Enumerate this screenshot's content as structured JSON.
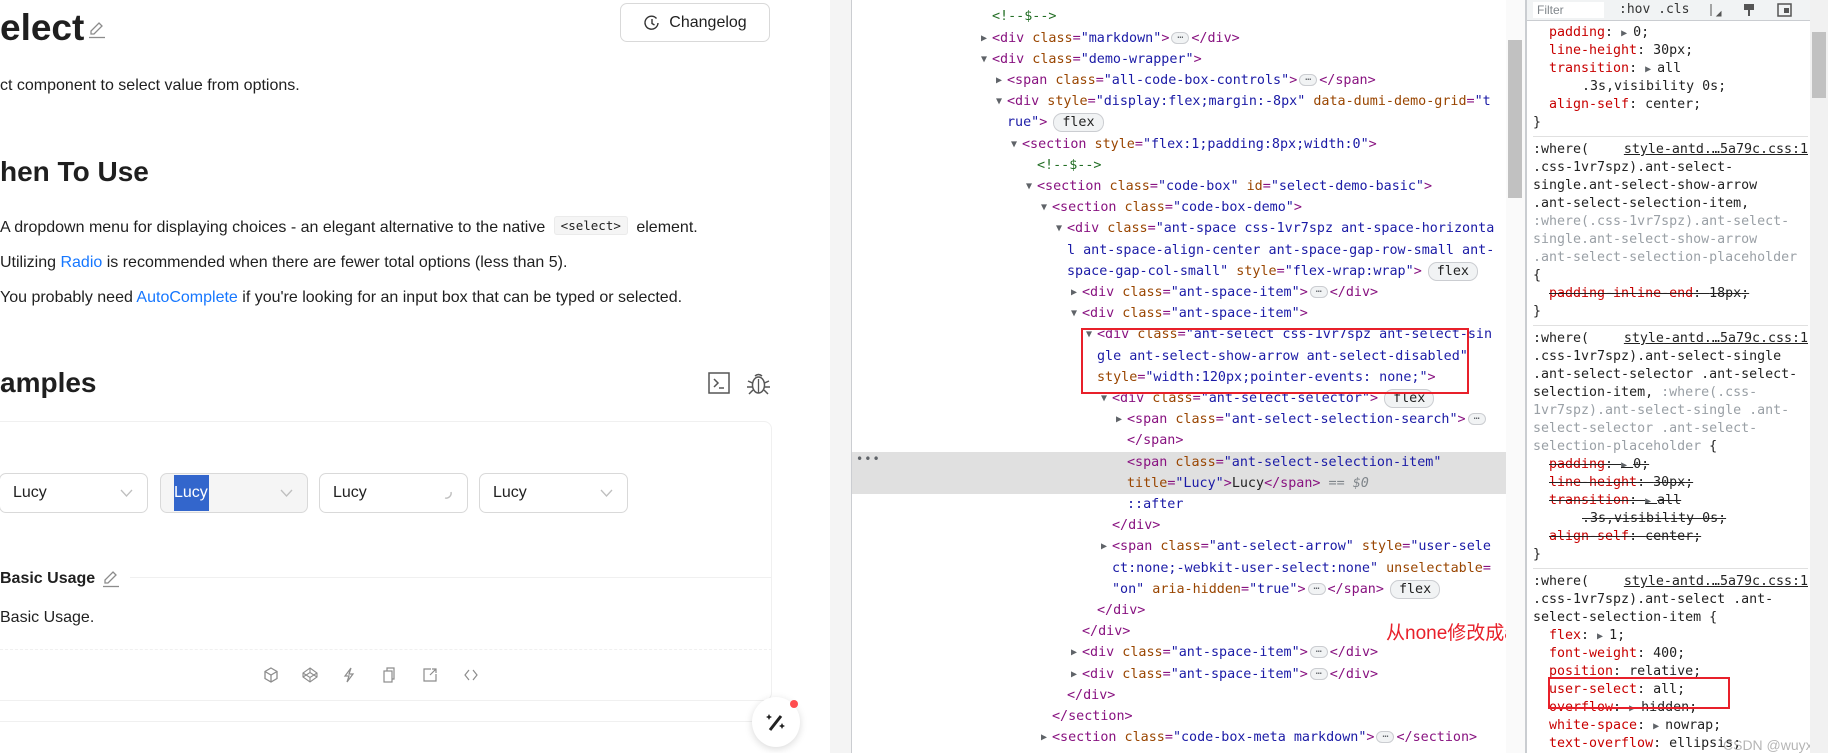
{
  "page": {
    "title": "elect",
    "changelog_label": "Changelog",
    "subtitle": "ct component to select value from options.",
    "when_heading": "hen To Use",
    "bullets": [
      {
        "pre": "A dropdown menu for displaying choices - an elegant alternative to the native ",
        "code": "<select>",
        "post": " element."
      },
      {
        "pre": "Utilizing ",
        "link": "Radio",
        "post": " is recommended when there are fewer total options (less than 5)."
      },
      {
        "pre": "You probably need ",
        "link": "AutoComplete",
        "post": " if you're looking for an input box that can be typed or selected."
      }
    ],
    "examples_heading": "amples",
    "accent": "#1677ff",
    "demo": {
      "selects": [
        {
          "value": "Lucy",
          "state": "default",
          "icon": "chevron-down"
        },
        {
          "value": "Lucy",
          "state": "disabled",
          "text_selected": true,
          "icon": "chevron-down"
        },
        {
          "value": "Lucy",
          "state": "loading",
          "icon": "spinner"
        },
        {
          "value": "Lucy",
          "state": "default",
          "icon": "chevron-down"
        }
      ],
      "title": "Basic Usage",
      "description": "Basic Usage.",
      "actions": [
        "codesandbox-icon",
        "codepen-icon",
        "stackblitz-icon",
        "copy-icon",
        "external-link-icon",
        "code-icon"
      ]
    }
  },
  "elements": {
    "lines": [
      {
        "d": 0,
        "seg": [
          [
            "comment",
            "<!--$-->"
          ]
        ]
      },
      {
        "d": 0,
        "arrow": "closed",
        "seg": [
          [
            "tag",
            "<div"
          ],
          [
            "attr",
            " class"
          ],
          [
            "tag",
            "="
          ],
          [
            "val",
            "\"markdown\""
          ],
          [
            "tag",
            ">"
          ],
          [
            "ell",
            "…"
          ],
          [
            "tag",
            "</div>"
          ]
        ]
      },
      {
        "d": 0,
        "arrow": "open",
        "seg": [
          [
            "tag",
            "<div"
          ],
          [
            "attr",
            " class"
          ],
          [
            "tag",
            "="
          ],
          [
            "val",
            "\"demo-wrapper\""
          ],
          [
            "tag",
            ">"
          ]
        ]
      },
      {
        "d": 1,
        "arrow": "closed",
        "seg": [
          [
            "tag",
            "<span"
          ],
          [
            "attr",
            " class"
          ],
          [
            "tag",
            "="
          ],
          [
            "val",
            "\"all-code-box-controls\""
          ],
          [
            "tag",
            ">"
          ],
          [
            "ell",
            "…"
          ],
          [
            "tag",
            "</span>"
          ]
        ]
      },
      {
        "d": 1,
        "arrow": "open",
        "seg": [
          [
            "tag",
            "<div"
          ],
          [
            "attr",
            " style"
          ],
          [
            "tag",
            "="
          ],
          [
            "val",
            "\"display:flex;margin:-8px\""
          ],
          [
            "attr",
            " data-dumi-demo-grid"
          ],
          [
            "tag",
            "="
          ],
          [
            "val",
            "\"t"
          ]
        ]
      },
      {
        "d": 1,
        "seg": [
          [
            "val",
            "rue\""
          ],
          [
            "tag",
            ">"
          ],
          [
            "badge",
            "flex"
          ]
        ]
      },
      {
        "d": 2,
        "arrow": "open",
        "seg": [
          [
            "tag",
            "<section"
          ],
          [
            "attr",
            " style"
          ],
          [
            "tag",
            "="
          ],
          [
            "val",
            "\"flex:1;padding:8px;width:0\""
          ],
          [
            "tag",
            ">"
          ]
        ]
      },
      {
        "d": 3,
        "seg": [
          [
            "comment",
            "<!--$-->"
          ]
        ]
      },
      {
        "d": 3,
        "arrow": "open",
        "seg": [
          [
            "tag",
            "<section"
          ],
          [
            "attr",
            " class"
          ],
          [
            "tag",
            "="
          ],
          [
            "val",
            "\"code-box\""
          ],
          [
            "attr",
            " id"
          ],
          [
            "tag",
            "="
          ],
          [
            "val",
            "\"select-demo-basic\""
          ],
          [
            "tag",
            ">"
          ]
        ]
      },
      {
        "d": 4,
        "arrow": "open",
        "seg": [
          [
            "tag",
            "<section"
          ],
          [
            "attr",
            " class"
          ],
          [
            "tag",
            "="
          ],
          [
            "val",
            "\"code-box-demo\""
          ],
          [
            "tag",
            ">"
          ]
        ]
      },
      {
        "d": 5,
        "arrow": "open",
        "seg": [
          [
            "tag",
            "<div"
          ],
          [
            "attr",
            " class"
          ],
          [
            "tag",
            "="
          ],
          [
            "val",
            "\"ant-space css-1vr7spz ant-space-horizonta"
          ]
        ]
      },
      {
        "d": 5,
        "seg": [
          [
            "val",
            "l ant-space-align-center ant-space-gap-row-small ant-"
          ]
        ]
      },
      {
        "d": 5,
        "seg": [
          [
            "val",
            "space-gap-col-small\""
          ],
          [
            "attr",
            " style"
          ],
          [
            "tag",
            "="
          ],
          [
            "val",
            "\"flex-wrap:wrap\""
          ],
          [
            "tag",
            ">"
          ],
          [
            "badge",
            "flex"
          ]
        ]
      },
      {
        "d": 6,
        "arrow": "closed",
        "seg": [
          [
            "tag",
            "<div"
          ],
          [
            "attr",
            " class"
          ],
          [
            "tag",
            "="
          ],
          [
            "val",
            "\"ant-space-item\""
          ],
          [
            "tag",
            ">"
          ],
          [
            "ell",
            "…"
          ],
          [
            "tag",
            "</div>"
          ]
        ]
      },
      {
        "d": 6,
        "arrow": "open",
        "seg": [
          [
            "tag",
            "<div"
          ],
          [
            "attr",
            " class"
          ],
          [
            "tag",
            "="
          ],
          [
            "val",
            "\"ant-space-item\""
          ],
          [
            "tag",
            ">"
          ]
        ]
      },
      {
        "d": 7,
        "arrow": "open",
        "seg": [
          [
            "tag",
            "<div"
          ],
          [
            "attr",
            " class"
          ],
          [
            "tag",
            "="
          ],
          [
            "val",
            "\"ant-select css-1vr7spz ant-select-sin"
          ]
        ]
      },
      {
        "d": 7,
        "seg": [
          [
            "val",
            "gle ant-select-show-arrow ant-select-disabled\""
          ]
        ]
      },
      {
        "d": 7,
        "seg": [
          [
            "attr",
            "style"
          ],
          [
            "tag",
            "="
          ],
          [
            "val",
            "\"width:120px;pointer-events: none;\""
          ],
          [
            "tag",
            ">"
          ]
        ]
      },
      {
        "d": 8,
        "arrow": "open",
        "seg": [
          [
            "tag",
            "<div"
          ],
          [
            "attr",
            " class"
          ],
          [
            "tag",
            "="
          ],
          [
            "val",
            "\"ant-select-selector\""
          ],
          [
            "tag",
            ">"
          ],
          [
            "badge",
            "flex"
          ]
        ]
      },
      {
        "d": 9,
        "arrow": "closed",
        "seg": [
          [
            "tag",
            "<span"
          ],
          [
            "attr",
            " class"
          ],
          [
            "tag",
            "="
          ],
          [
            "val",
            "\"ant-select-selection-search\""
          ],
          [
            "tag",
            ">"
          ],
          [
            "ell",
            "…"
          ]
        ]
      },
      {
        "d": 9,
        "seg": [
          [
            "tag",
            "</span>"
          ]
        ]
      },
      {
        "d": 9,
        "selected": true,
        "dots": "•••",
        "seg": [
          [
            "tag",
            "<span"
          ],
          [
            "attr",
            " class"
          ],
          [
            "tag",
            "="
          ],
          [
            "val",
            "\"ant-select-selection-item\""
          ]
        ]
      },
      {
        "d": 9,
        "selected": true,
        "seg": [
          [
            "attr",
            "title"
          ],
          [
            "tag",
            "="
          ],
          [
            "val",
            "\"Lucy\""
          ],
          [
            "tag",
            ">"
          ],
          [
            "text",
            "Lucy"
          ],
          [
            "tag",
            "</span>"
          ],
          [
            "dollar",
            " == $0"
          ]
        ]
      },
      {
        "d": 9,
        "seg": [
          [
            "pseudo",
            "::after"
          ]
        ]
      },
      {
        "d": 8,
        "seg": [
          [
            "tag",
            "</div>"
          ]
        ]
      },
      {
        "d": 8,
        "arrow": "closed",
        "seg": [
          [
            "tag",
            "<span"
          ],
          [
            "attr",
            " class"
          ],
          [
            "tag",
            "="
          ],
          [
            "val",
            "\"ant-select-arrow\""
          ],
          [
            "attr",
            " style"
          ],
          [
            "tag",
            "="
          ],
          [
            "val",
            "\"user-sele"
          ]
        ]
      },
      {
        "d": 8,
        "seg": [
          [
            "val",
            "ct:none;-webkit-user-select:none\""
          ],
          [
            "attr",
            " unselectable"
          ],
          [
            "tag",
            "="
          ]
        ]
      },
      {
        "d": 8,
        "seg": [
          [
            "val",
            "\"on\""
          ],
          [
            "attr",
            " aria-hidden"
          ],
          [
            "tag",
            "="
          ],
          [
            "val",
            "\"true\""
          ],
          [
            "tag",
            ">"
          ],
          [
            "ell",
            "…"
          ],
          [
            "tag",
            "</span>"
          ],
          [
            "badge",
            "flex"
          ]
        ]
      },
      {
        "d": 7,
        "seg": [
          [
            "tag",
            "</div>"
          ]
        ]
      },
      {
        "d": 6,
        "seg": [
          [
            "tag",
            "</div>"
          ]
        ]
      },
      {
        "d": 6,
        "arrow": "closed",
        "seg": [
          [
            "tag",
            "<div"
          ],
          [
            "attr",
            " class"
          ],
          [
            "tag",
            "="
          ],
          [
            "val",
            "\"ant-space-item\""
          ],
          [
            "tag",
            ">"
          ],
          [
            "ell",
            "…"
          ],
          [
            "tag",
            "</div>"
          ]
        ]
      },
      {
        "d": 6,
        "arrow": "closed",
        "seg": [
          [
            "tag",
            "<div"
          ],
          [
            "attr",
            " class"
          ],
          [
            "tag",
            "="
          ],
          [
            "val",
            "\"ant-space-item\""
          ],
          [
            "tag",
            ">"
          ],
          [
            "ell",
            "…"
          ],
          [
            "tag",
            "</div>"
          ]
        ]
      },
      {
        "d": 5,
        "seg": [
          [
            "tag",
            "</div>"
          ]
        ]
      },
      {
        "d": 4,
        "seg": [
          [
            "tag",
            "</section>"
          ]
        ]
      },
      {
        "d": 4,
        "arrow": "closed",
        "seg": [
          [
            "tag",
            "<section"
          ],
          [
            "attr",
            " class"
          ],
          [
            "tag",
            "="
          ],
          [
            "val",
            "\"code-box-meta markdown\""
          ],
          [
            "tag",
            ">"
          ],
          [
            "ell",
            "…"
          ],
          [
            "tag",
            "</section>"
          ]
        ]
      }
    ],
    "annotation": "从none修改成all",
    "annotation_color": "#e8202a"
  },
  "styles": {
    "filter_placeholder": "Filter",
    "hov_cls": ":hov .cls",
    "rules": [
      {
        "lines": [
          {
            "p": "padding",
            "v": "0",
            "arrow": true
          },
          {
            "p": "line-height",
            "v": "30px"
          },
          {
            "p": "transition",
            "v": "all",
            "arrow": true,
            "semi": false
          },
          {
            "c": ".3s,visibility 0s;"
          },
          {
            "p": "align-self",
            "v": "center"
          },
          {
            "b": "}"
          }
        ]
      },
      {
        "lines": [
          {
            "segs": [
              [
                "s",
                ":where("
              ]
            ],
            "link": "style-antd.…5a79c.css:1"
          },
          {
            "segs": [
              [
                "s",
                ".css-1vr7spz).ant-select-"
              ]
            ]
          },
          {
            "segs": [
              [
                "s",
                "single.ant-select-show-arrow"
              ]
            ]
          },
          {
            "segs": [
              [
                "s",
                ".ant-select-selection-item,"
              ]
            ]
          },
          {
            "segs": [
              [
                "g",
                ":where(.css-1vr7spz).ant-select-"
              ]
            ]
          },
          {
            "segs": [
              [
                "g",
                "single.ant-select-show-arrow"
              ]
            ]
          },
          {
            "segs": [
              [
                "g",
                ".ant-select-selection-placeholder"
              ]
            ]
          },
          {
            "b": "{"
          },
          {
            "p": "padding-inline-end",
            "v": "18px",
            "x": true
          },
          {
            "b": "}"
          }
        ]
      },
      {
        "lines": [
          {
            "segs": [
              [
                "s",
                ":where("
              ]
            ],
            "link": "style-antd.…5a79c.css:1"
          },
          {
            "segs": [
              [
                "s",
                ".css-1vr7spz).ant-select-single"
              ]
            ]
          },
          {
            "segs": [
              [
                "s",
                ".ant-select-selector .ant-select-"
              ]
            ]
          },
          {
            "segs": [
              [
                "s",
                "selection-item, "
              ],
              [
                "g",
                ":where(.css-"
              ]
            ]
          },
          {
            "segs": [
              [
                "g",
                "1vr7spz).ant-select-single .ant-"
              ]
            ]
          },
          {
            "segs": [
              [
                "g",
                "select-selector .ant-select-"
              ]
            ]
          },
          {
            "segs": [
              [
                "g",
                "selection-placeholder"
              ],
              [
                "s",
                " {"
              ]
            ]
          },
          {
            "p": "padding",
            "v": "0",
            "arrow": true,
            "x": true
          },
          {
            "p": "line-height",
            "v": "30px",
            "x": true
          },
          {
            "p": "transition",
            "v": "all",
            "arrow": true,
            "x": true,
            "semi": false
          },
          {
            "c": ".3s,visibility 0s;",
            "x": true
          },
          {
            "p": "align-self",
            "v": "center",
            "x": true
          },
          {
            "b": "}"
          }
        ]
      },
      {
        "lines": [
          {
            "segs": [
              [
                "s",
                ":where("
              ]
            ],
            "link": "style-antd.…5a79c.css:1"
          },
          {
            "segs": [
              [
                "s",
                ".css-1vr7spz).ant-select .ant-"
              ]
            ]
          },
          {
            "segs": [
              [
                "s",
                "select-selection-item {"
              ]
            ]
          },
          {
            "p": "flex",
            "v": "1",
            "arrow": true
          },
          {
            "p": "font-weight",
            "v": "400"
          },
          {
            "p": "position",
            "v": "relative"
          },
          {
            "p": "user-select",
            "v": "all"
          },
          {
            "p": "overflow",
            "v": "hidden",
            "arrow": true
          },
          {
            "p": "white-space",
            "v": "nowrap",
            "arrow": true
          },
          {
            "p": "text-overflow",
            "v": "ellipsis"
          },
          {
            "b": "}"
          }
        ]
      }
    ],
    "watermark": "CSDN @wuyxinu"
  }
}
